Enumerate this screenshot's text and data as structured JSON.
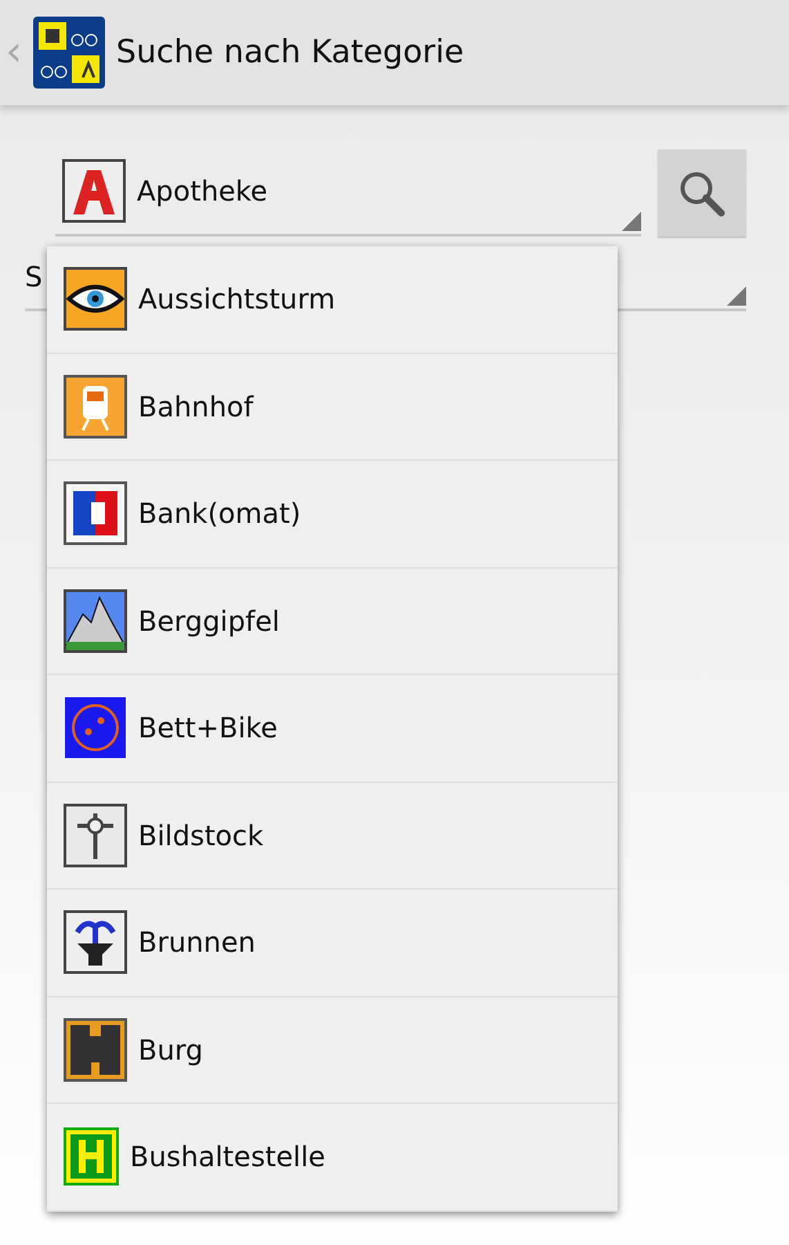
{
  "header": {
    "back": "‹",
    "title": "Suche nach Kategorie"
  },
  "category_spinner": {
    "value": "Apotheke",
    "kind": "pharmacy"
  },
  "second_spinner": {
    "value": "S"
  },
  "dropdown": {
    "items": [
      {
        "label": "Aussichtsturm",
        "kind": "eye"
      },
      {
        "label": "Bahnhof",
        "kind": "train"
      },
      {
        "label": "Bank(omat)",
        "kind": "ec"
      },
      {
        "label": "Berggipfel",
        "kind": "mountain"
      },
      {
        "label": "Bett+Bike",
        "kind": "bed"
      },
      {
        "label": "Bildstock",
        "kind": "cross"
      },
      {
        "label": "Brunnen",
        "kind": "fountain"
      },
      {
        "label": "Burg",
        "kind": "castle"
      },
      {
        "label": "Bushaltestelle",
        "kind": "bus"
      }
    ]
  }
}
